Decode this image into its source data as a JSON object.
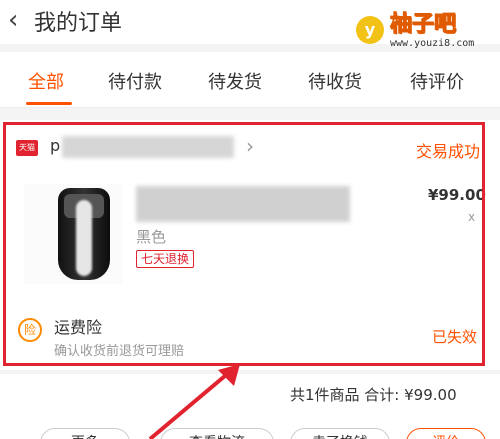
{
  "header": {
    "back_icon": "chevron-left-icon",
    "title": "我的订单"
  },
  "watermark": {
    "logo_letter": "y",
    "name": "柚子吧",
    "url": "www.youzi8.com"
  },
  "tabs": [
    {
      "label": "全部",
      "active": true
    },
    {
      "label": "待付款",
      "active": false
    },
    {
      "label": "待发货",
      "active": false
    },
    {
      "label": "待收货",
      "active": false
    },
    {
      "label": "待评价",
      "active": false
    }
  ],
  "order": {
    "shop_badge": "天猫",
    "shop_name_visible": "p",
    "status": "交易成功",
    "product": {
      "spec": "黑色",
      "badge": "七天退换",
      "price": "¥99.00",
      "qty": "x"
    },
    "insurance": {
      "icon_text": "险",
      "title": "运费险",
      "subtitle": "确认收货前退货可理赔",
      "status": "已失效"
    }
  },
  "summary": {
    "text": "共1件商品  合计: ¥99.00"
  },
  "actions": [
    {
      "label": "更多"
    },
    {
      "label": "查看物流"
    },
    {
      "label": "卖了换钱"
    },
    {
      "label": "评价"
    }
  ],
  "colors": {
    "accent": "#ff5000",
    "highlight": "#e0232e",
    "tmall_red": "#e0232e"
  }
}
